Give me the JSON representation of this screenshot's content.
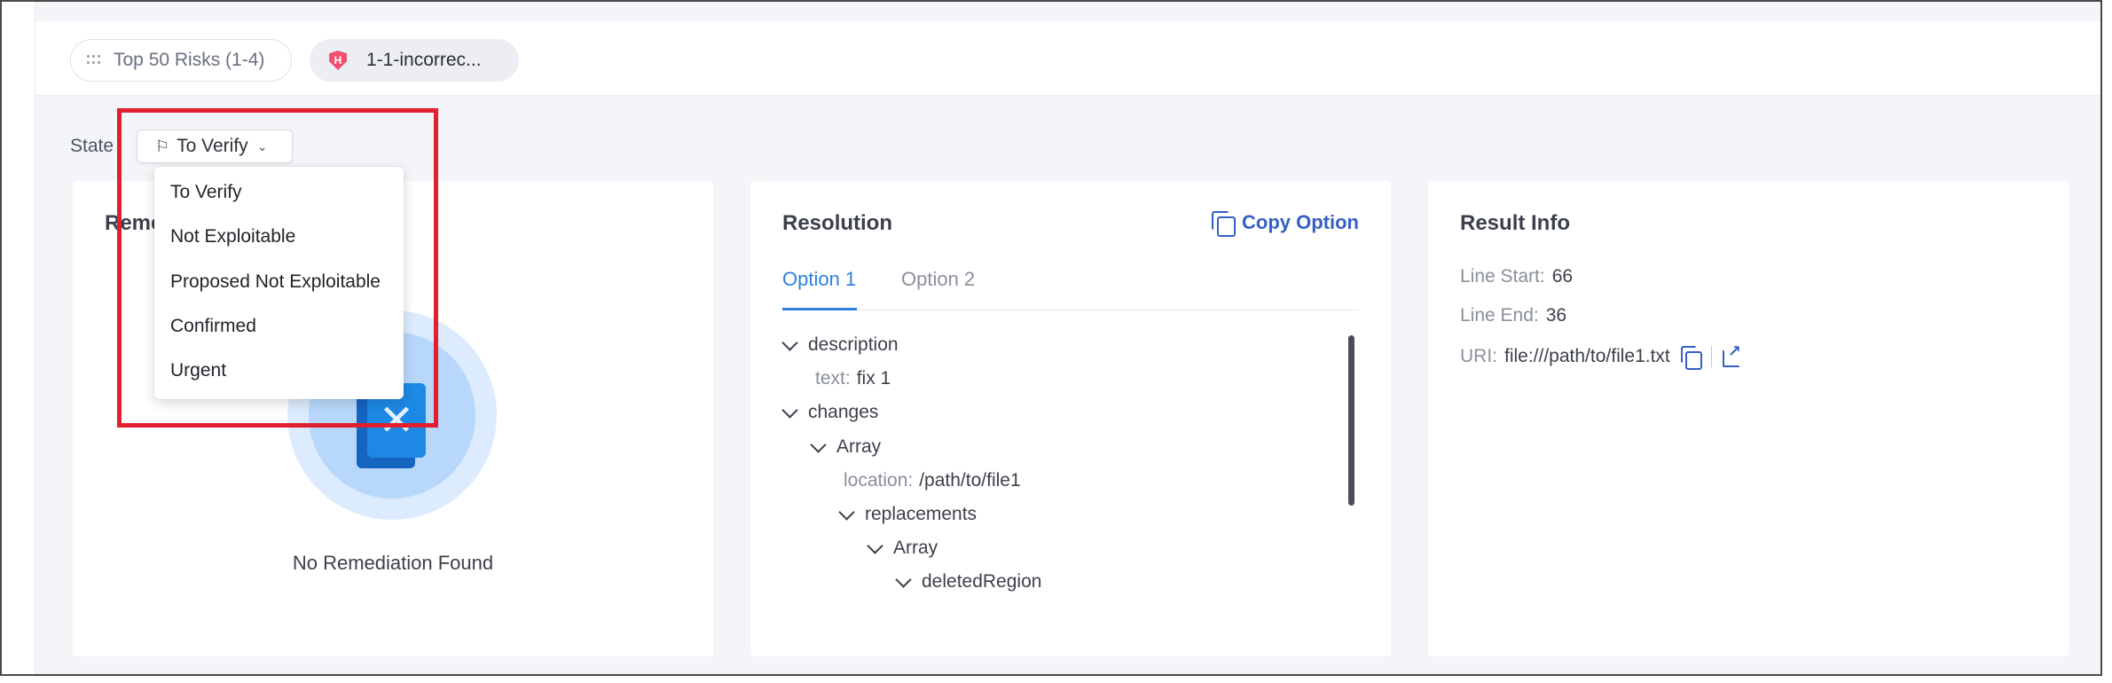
{
  "breadcrumbs": {
    "top_risks": "Top 50 Risks (1-4)",
    "result_name": "1-1-incorrec...",
    "severity_letter": "H"
  },
  "state": {
    "label": "State",
    "selected": "To Verify",
    "options": [
      "To Verify",
      "Not Exploitable",
      "Proposed Not Exploitable",
      "Confirmed",
      "Urgent"
    ]
  },
  "remediation": {
    "title": "Reme",
    "empty_text": "No Remediation Found"
  },
  "resolution": {
    "title": "Resolution",
    "copy_label": "Copy Option",
    "tabs": [
      "Option 1",
      "Option 2"
    ],
    "active_tab": "Option 1",
    "tree": [
      {
        "type": "node",
        "label": "description"
      },
      {
        "type": "kv",
        "key": "text:",
        "value": "fix 1"
      },
      {
        "type": "node",
        "label": "changes"
      },
      {
        "type": "node",
        "label": "Array"
      },
      {
        "type": "kv",
        "key": "location:",
        "value": "/path/to/file1"
      },
      {
        "type": "node",
        "label": "replacements"
      },
      {
        "type": "node",
        "label": "Array"
      },
      {
        "type": "node",
        "label": "deletedRegion"
      }
    ]
  },
  "result_info": {
    "title": "Result Info",
    "line_start_label": "Line Start:",
    "line_start": "66",
    "line_end_label": "Line End:",
    "line_end": "36",
    "uri_label": "URI:",
    "uri": "file:///path/to/file1.txt"
  },
  "colors": {
    "accent": "#2f7fe0",
    "link": "#3560c4",
    "highlight": "#e0202e",
    "severity_high": "#f0506e"
  }
}
